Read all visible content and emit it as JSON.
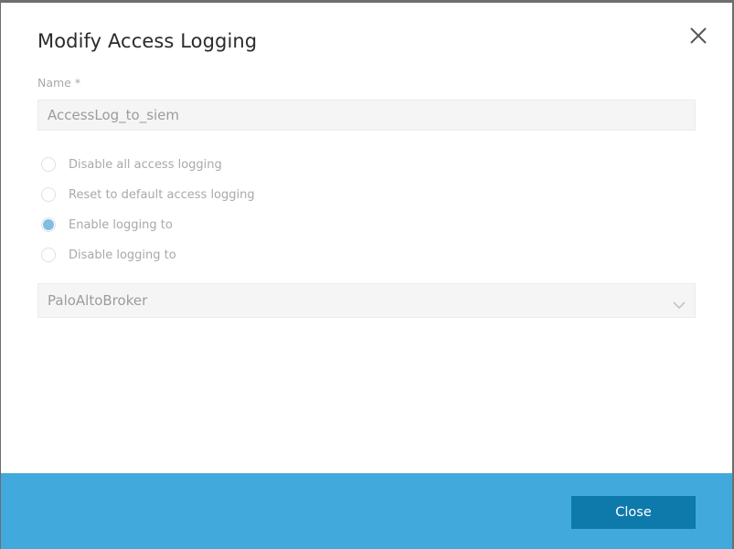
{
  "dialog": {
    "title": "Modify Access Logging",
    "close_icon": "close-icon"
  },
  "name_field": {
    "label": "Name *",
    "value": "AccessLog_to_siem"
  },
  "logging_options": [
    {
      "label": "Disable all access logging",
      "checked": false
    },
    {
      "label": "Reset to default access logging",
      "checked": false
    },
    {
      "label": "Enable logging to",
      "checked": true
    },
    {
      "label": "Disable logging to",
      "checked": false
    }
  ],
  "target_select": {
    "value": "PaloAltoBroker",
    "icon": "chevron-down-icon"
  },
  "footer": {
    "close_label": "Close"
  },
  "colors": {
    "footer_background": "#42a9dc",
    "primary_button": "#0e79ab",
    "radio_checked": "#7fbde3"
  }
}
